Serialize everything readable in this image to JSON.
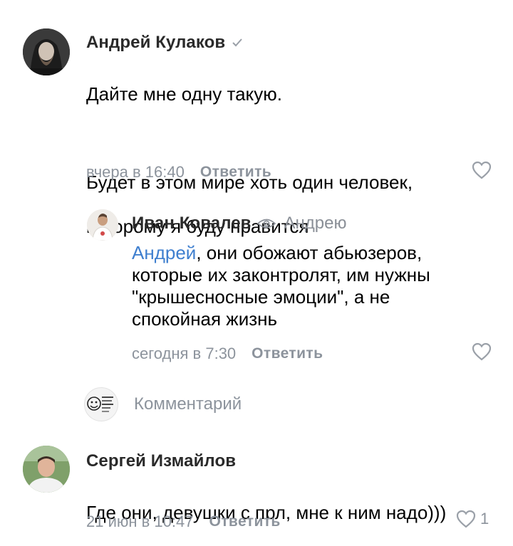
{
  "comments": [
    {
      "author": "Андрей Кулаков",
      "verified": true,
      "lines": [
        "Дайте мне одну такую.",
        "",
        "Будет в этом мире хоть один человек,",
        "которому я буду нравится"
      ],
      "date": "вчера в 16:40",
      "reply_label": "Ответить",
      "avatar_icon": "bearded-man-portrait"
    },
    {
      "author": "Иван Ковалев",
      "badge_icon": "eye-icon",
      "reply_to": "Андрею",
      "mention": "Андрей",
      "text_after_mention": ", они обожают абьюзеров,\nкоторые их законтролят, им нужны\n\"крышесносные эмоции\", а не\nспокойная жизнь",
      "date": "сегодня в 7:30",
      "reply_label": "Ответить",
      "avatar_icon": "man-in-white-shirt-portrait"
    },
    {
      "author": "Сергей Измайлов",
      "lines": [
        "Где они, девушки с прл, мне к ним надо)))"
      ],
      "date": "21 июн в 10:47",
      "reply_label": "Ответить",
      "likes": "1",
      "avatar_icon": "man-portrait"
    }
  ],
  "composer": {
    "placeholder": "Комментарий",
    "avatar_icon": "meme-face-avatar"
  },
  "colors": {
    "meta": "#8c939c",
    "mention": "#3f7fcf",
    "text": "#000000"
  }
}
